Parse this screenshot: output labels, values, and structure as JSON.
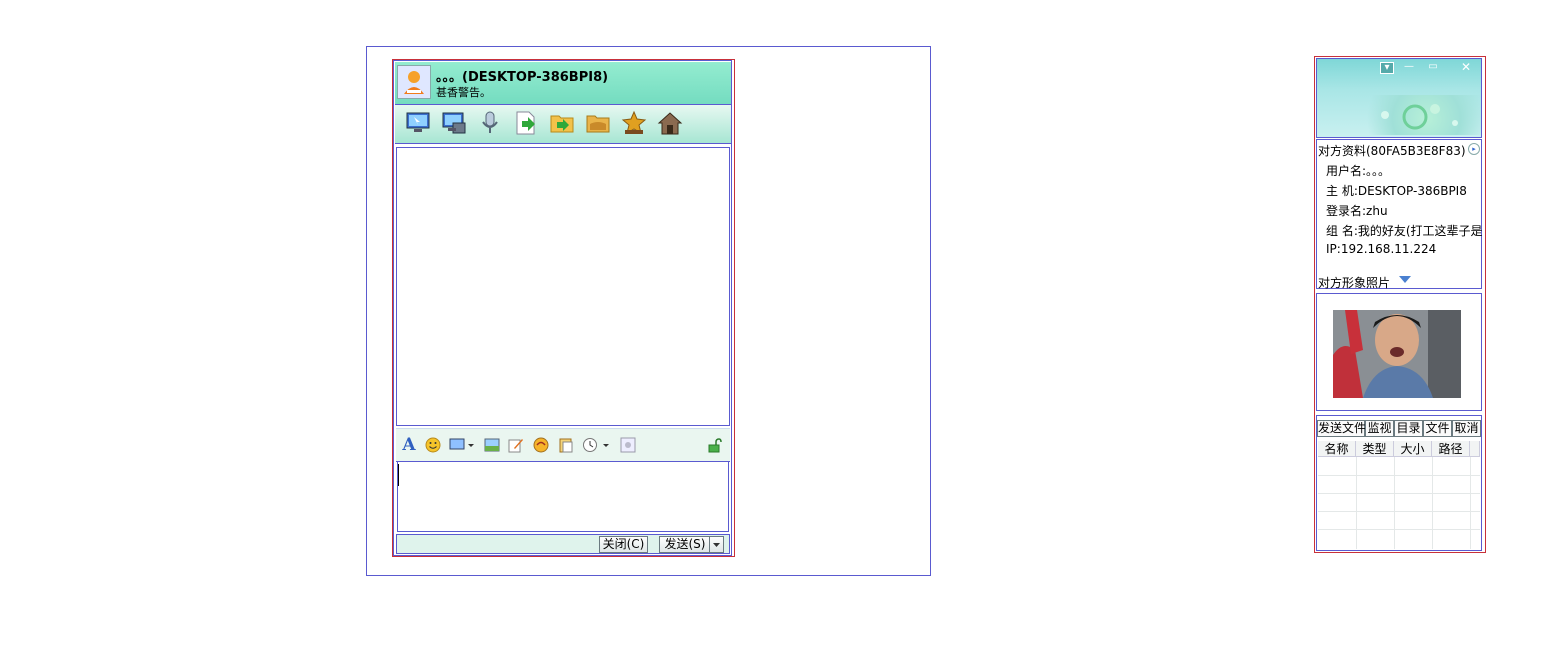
{
  "chat": {
    "contact_name": "。。。(DESKTOP-386BPI8)",
    "contact_status": "甚香警告。",
    "buttons": {
      "close": "关闭(C)",
      "send": "发送(S)"
    },
    "toolbar_icons": [
      "remote-desktop-icon",
      "remote-assist-icon",
      "voice-microphone-icon",
      "send-file-icon",
      "send-folder-icon",
      "shared-folder-icon",
      "contact-star-icon",
      "home-icon"
    ],
    "format_icons": [
      "font-icon",
      "emoji-icon",
      "screenshot-icon",
      "image-icon",
      "edit-note-icon",
      "shake-icon",
      "paste-icon",
      "history-clock-icon",
      "more-icon",
      "lock-icon"
    ]
  },
  "side": {
    "info_title": "对方资料(80FA5B3E8F83)",
    "username": "用户名:。。。",
    "host": "主  机:DESKTOP-386BPI8",
    "login": "登录名:zhu",
    "group": "组  名:我的好友(打工这辈子是",
    "ip": "IP:192.168.11.224",
    "photo_label": "对方形象照片",
    "file_tabs": [
      "发送文件",
      "监视",
      "目录",
      "文件",
      "取消"
    ],
    "file_columns": [
      "名称",
      "类型",
      "大小",
      "路径"
    ]
  },
  "colors": {
    "header_green": "#94ecd0",
    "frame_blue": "#5a5ad0",
    "frame_red": "#c8303a"
  }
}
